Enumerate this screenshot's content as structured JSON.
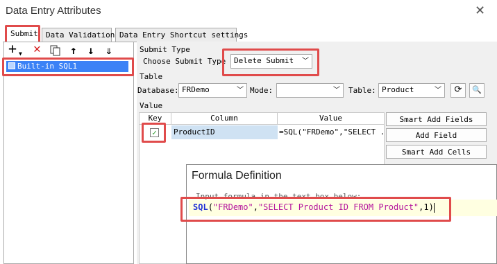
{
  "window": {
    "title": "Data Entry Attributes",
    "close_glyph": "✕"
  },
  "tabs": [
    {
      "label": "Submit",
      "active": true
    },
    {
      "label": "Data Validation",
      "active": false
    },
    {
      "label": "Data Entry Shortcut settings",
      "active": false
    }
  ],
  "toolbar": {
    "icons": [
      "add-icon",
      "delete-icon",
      "copy-icon",
      "move-up-icon",
      "move-down-icon",
      "order-icon"
    ]
  },
  "left_list": {
    "items": [
      {
        "label": "Built-in SQL1",
        "selected": true
      }
    ]
  },
  "submit_type": {
    "section_label": "Submit Type",
    "choose_label": "Choose Submit Type",
    "value": "Delete Submit"
  },
  "table": {
    "section_label": "Table",
    "database_label": "Database:",
    "database_value": "FRDemo",
    "mode_label": "Mode:",
    "mode_value": "",
    "table_label": "Table:",
    "table_value": "Product"
  },
  "value": {
    "section_label": "Value",
    "columns": [
      "Key",
      "Column",
      "Value"
    ],
    "rows": [
      {
        "key_checked": true,
        "column": "ProductID",
        "value": "=SQL(\"FRDemo\",\"SELECT ..."
      }
    ],
    "buttons": [
      "Smart Add Fields",
      "Add Field",
      "Smart Add Cells"
    ]
  },
  "formula_dialog": {
    "title": "Formula Definition",
    "hint": "Input formula in the text box below:",
    "code_fn": "SQL",
    "code_open": "(",
    "code_arg1": "\"FRDemo\"",
    "code_comma1": ",",
    "code_arg2": "\"SELECT Product ID FROM Product\"",
    "code_rest": ",1)"
  },
  "colors": {
    "highlight": "#e04b4b",
    "selection": "#3b82f6",
    "keyword": "#1f2fd6",
    "string": "#b5179e"
  }
}
